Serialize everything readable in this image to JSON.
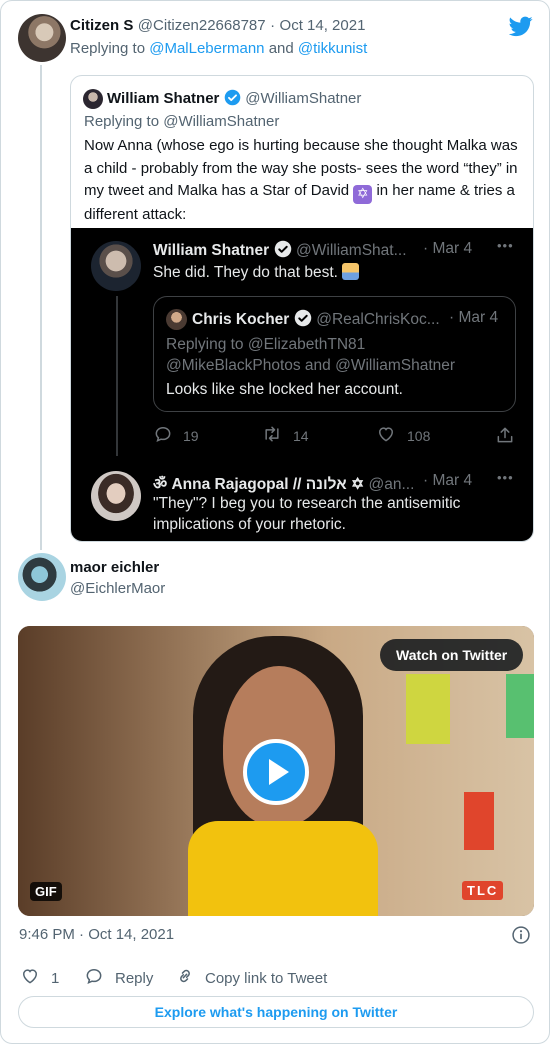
{
  "tweet": {
    "author_name": "Citizen S",
    "author_handle": "@Citizen22668787",
    "dot": "·",
    "date": "Oct 14, 2021",
    "replying_prefix": "Replying to",
    "replying_to_1": "@MalLebermann",
    "replying_and": "and",
    "replying_to_2": "@tikkunist"
  },
  "quoted": {
    "author_name": "William Shatner",
    "author_handle": "@WilliamShatner",
    "replying_prefix": "Replying to",
    "replying_to": "@WilliamShatner",
    "text_1": "Now Anna (whose ego is hurting because she thought Malka was a child - probably from the way she posts- sees the word “they” in my tweet and Malka has a Star of David ",
    "star_emoji": "✡",
    "text_2": " in her name & tries a different attack:",
    "screenshot": {
      "post1_name": "William Shatner",
      "post1_handle": "@WilliamShat...",
      "post1_date": "· Mar 4",
      "post1_text": "She did. They do that best.",
      "post1_emoji": "🤷‍♂️",
      "more": "•••",
      "inner_name": "Chris Kocher",
      "inner_handle": "@RealChrisKoc...",
      "inner_date": "· Mar 4",
      "inner_reply_line_1": "Replying to @ElizabethTN81",
      "inner_reply_line_2": "@MikeBlackPhotos and @WilliamShatner",
      "inner_text": "Looks like she locked her account.",
      "replies": "19",
      "retweets": "14",
      "likes": "108",
      "post2_name": "ॐ Anna Rajagopal // אלונה ✡",
      "post2_handle": "@an...",
      "post2_date": "· Mar 4",
      "post2_text_1": "\"They\"? I beg you to research the antisemitic",
      "post2_text_2": "implications of your rhetoric."
    }
  },
  "reply": {
    "author_name": "maor eichler",
    "author_handle": "@EichlerMaor",
    "video_button": "Watch on Twitter",
    "gif_badge": "GIF",
    "tlc_logo": "TLC",
    "time": "9:46 PM · Oct 14, 2021",
    "like_count": "1",
    "reply_label": "Reply",
    "copy_link_label": "Copy link to Tweet",
    "explore_label": "Explore what's happening on Twitter"
  },
  "colors": {
    "accent": "#1d9bf0",
    "text": "#0f1419",
    "muted": "#536471",
    "border": "#cfd9de"
  },
  "icons": [
    "twitter-bird-icon",
    "verified-badge-icon",
    "play-icon",
    "info-icon",
    "heart-icon",
    "reply-icon",
    "link-icon",
    "retweet-icon",
    "share-icon",
    "more-icon"
  ]
}
